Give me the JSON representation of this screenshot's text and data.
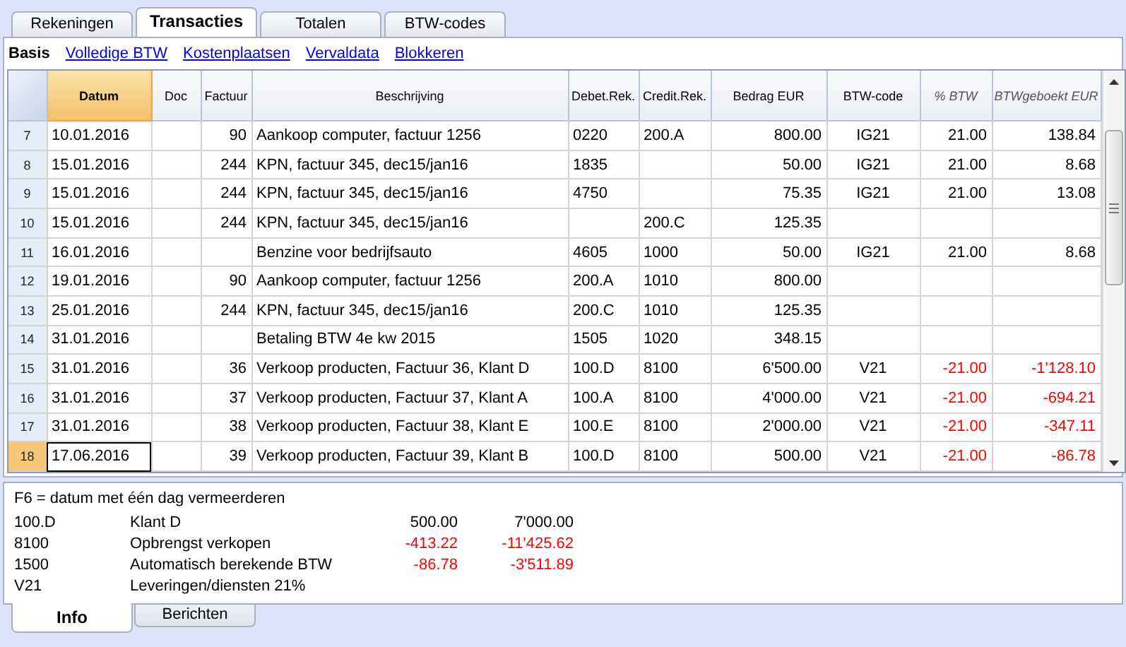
{
  "tabs": [
    {
      "label": "Rekeningen",
      "selected": false
    },
    {
      "label": "Transacties",
      "selected": true
    },
    {
      "label": "Totalen",
      "selected": false
    },
    {
      "label": "BTW-codes",
      "selected": false
    }
  ],
  "views": [
    {
      "label": "Basis",
      "selected": true
    },
    {
      "label": "Volledige BTW",
      "selected": false
    },
    {
      "label": "Kostenplaatsen",
      "selected": false
    },
    {
      "label": "Vervaldata",
      "selected": false
    },
    {
      "label": "Blokkeren",
      "selected": false
    }
  ],
  "table": {
    "columns": [
      {
        "label": "Datum",
        "selected": true,
        "italic": false
      },
      {
        "label": "Doc",
        "selected": false,
        "italic": false
      },
      {
        "label": "Factuur",
        "selected": false,
        "italic": false
      },
      {
        "label": "Beschrijving",
        "selected": false,
        "italic": false
      },
      {
        "label": "Debet.Rek.",
        "selected": false,
        "italic": false
      },
      {
        "label": "Credit.Rek.",
        "selected": false,
        "italic": false
      },
      {
        "label": "Bedrag EUR",
        "selected": false,
        "italic": false
      },
      {
        "label": "BTW-code",
        "selected": false,
        "italic": false
      },
      {
        "label": "% BTW",
        "selected": false,
        "italic": true
      },
      {
        "label": "BTWgeboekt EUR",
        "selected": false,
        "italic": true
      }
    ],
    "rows": [
      {
        "number": "7",
        "selected": false,
        "negative": false,
        "cells": [
          "10.01.2016",
          "",
          "90",
          "Aankoop computer, factuur 1256",
          "0220",
          "200.A",
          "800.00",
          "IG21",
          "21.00",
          "138.84"
        ]
      },
      {
        "number": "8",
        "selected": false,
        "negative": false,
        "cells": [
          "15.01.2016",
          "",
          "244",
          "KPN, factuur 345, dec15/jan16",
          "1835",
          "",
          "50.00",
          "IG21",
          "21.00",
          "8.68"
        ]
      },
      {
        "number": "9",
        "selected": false,
        "negative": false,
        "cells": [
          "15.01.2016",
          "",
          "244",
          "KPN, factuur 345, dec15/jan16",
          "4750",
          "",
          "75.35",
          "IG21",
          "21.00",
          "13.08"
        ]
      },
      {
        "number": "10",
        "selected": false,
        "negative": false,
        "cells": [
          "15.01.2016",
          "",
          "244",
          "KPN, factuur 345, dec15/jan16",
          "",
          "200.C",
          "125.35",
          "",
          "",
          ""
        ]
      },
      {
        "number": "11",
        "selected": false,
        "negative": false,
        "cells": [
          "16.01.2016",
          "",
          "",
          "Benzine voor bedrijfsauto",
          "4605",
          "1000",
          "50.00",
          "IG21",
          "21.00",
          "8.68"
        ]
      },
      {
        "number": "12",
        "selected": false,
        "negative": false,
        "cells": [
          "19.01.2016",
          "",
          "90",
          "Aankoop computer, factuur 1256",
          "200.A",
          "1010",
          "800.00",
          "",
          "",
          ""
        ]
      },
      {
        "number": "13",
        "selected": false,
        "negative": false,
        "cells": [
          "25.01.2016",
          "",
          "244",
          "KPN, factuur 345, dec15/jan16",
          "200.C",
          "1010",
          "125.35",
          "",
          "",
          ""
        ]
      },
      {
        "number": "14",
        "selected": false,
        "negative": false,
        "cells": [
          "31.01.2016",
          "",
          "",
          "Betaling BTW 4e kw 2015",
          "1505",
          "1020",
          "348.15",
          "",
          "",
          ""
        ]
      },
      {
        "number": "15",
        "selected": false,
        "negative": true,
        "cells": [
          "31.01.2016",
          "",
          "36",
          "Verkoop producten, Factuur 36, Klant D",
          "100.D",
          "8100",
          "6'500.00",
          "V21",
          "-21.00",
          "-1'128.10"
        ]
      },
      {
        "number": "16",
        "selected": false,
        "negative": true,
        "cells": [
          "31.01.2016",
          "",
          "37",
          "Verkoop producten, Factuur 37, Klant A",
          "100.A",
          "8100",
          "4'000.00",
          "V21",
          "-21.00",
          "-694.21"
        ]
      },
      {
        "number": "17",
        "selected": false,
        "negative": true,
        "cells": [
          "31.01.2016",
          "",
          "38",
          "Verkoop producten, Factuur 38, Klant E",
          "100.E",
          "8100",
          "2'000.00",
          "V21",
          "-21.00",
          "-347.11"
        ]
      },
      {
        "number": "18",
        "selected": true,
        "negative": true,
        "cells": [
          "17.06.2016",
          "",
          "39",
          "Verkoop producten, Factuur 39, Klant B",
          "100.D",
          "8100",
          "500.00",
          "V21",
          "-21.00",
          "-86.78"
        ]
      }
    ]
  },
  "info": {
    "hint": "F6 = datum met één dag vermeerderen",
    "lines": [
      {
        "account": "100.D",
        "description": "Klant D",
        "amount": "500.00",
        "total": "7'000.00",
        "negative": false
      },
      {
        "account": "8100",
        "description": "Opbrengst verkopen",
        "amount": "-413.22",
        "total": "-11'425.62",
        "negative": true
      },
      {
        "account": "1500",
        "description": "Automatisch berekende BTW",
        "amount": "-86.78",
        "total": "-3'511.89",
        "negative": true
      },
      {
        "account": "V21",
        "description": "Leveringen/diensten 21%"
      }
    ]
  },
  "bottom_tabs": [
    {
      "label": "Info",
      "selected": true
    },
    {
      "label": "Berichten",
      "selected": false
    }
  ]
}
